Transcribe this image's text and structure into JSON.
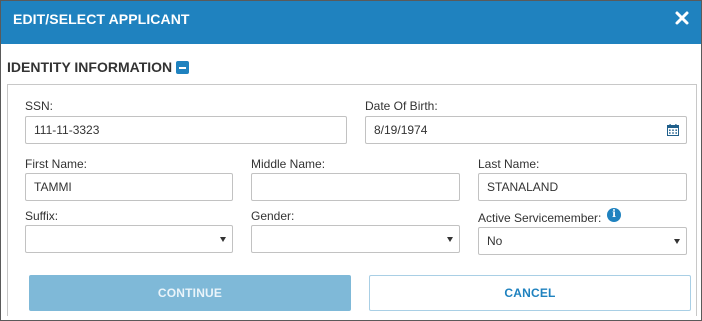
{
  "dialog": {
    "title": "EDIT/SELECT APPLICANT",
    "close_icon": "close-icon"
  },
  "section": {
    "title": "IDENTITY INFORMATION",
    "toggle_icon": "minus-square-icon"
  },
  "form": {
    "ssn": {
      "label": "SSN:",
      "value": "111-11-3323"
    },
    "dob": {
      "label": "Date Of Birth:",
      "value": "8/19/1974",
      "icon": "calendar-icon"
    },
    "first_name": {
      "label": "First Name:",
      "value": "TAMMI"
    },
    "middle_name": {
      "label": "Middle Name:",
      "value": ""
    },
    "last_name": {
      "label": "Last Name:",
      "value": "STANALAND"
    },
    "suffix": {
      "label": "Suffix:",
      "value": ""
    },
    "gender": {
      "label": "Gender:",
      "value": ""
    },
    "servicemember": {
      "label": "Active Servicemember:",
      "value": "No",
      "info_icon": "info-icon",
      "info_glyph": "i"
    }
  },
  "buttons": {
    "continue": "CONTINUE",
    "cancel": "CANCEL"
  },
  "colors": {
    "header_blue": "#1f82bf",
    "continue_disabled": "#7fb9d8"
  }
}
